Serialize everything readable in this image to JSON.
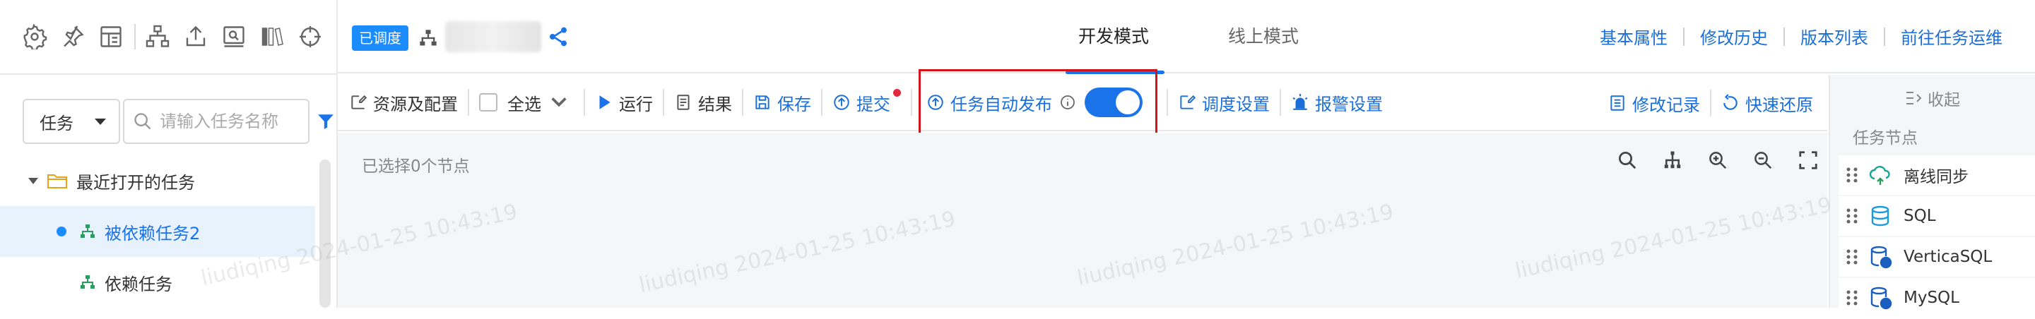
{
  "sidebar": {
    "search": {
      "type_value": "任务",
      "placeholder": "请输入任务名称"
    },
    "tree": [
      {
        "label": "最近打开的任务"
      },
      {
        "label": "被依赖任务2"
      },
      {
        "label": "依赖任务"
      }
    ]
  },
  "header": {
    "status_badge": "已调度",
    "modes": {
      "active": "开发模式",
      "inactive": "线上模式"
    },
    "links": [
      "基本属性",
      "修改历史",
      "版本列表",
      "前往任务运维"
    ]
  },
  "toolbar": {
    "resources": "资源及配置",
    "select_all": "全选",
    "run": "运行",
    "result": "结果",
    "save": "保存",
    "submit": "提交",
    "auto_publish": "任务自动发布",
    "auto_publish_enabled": true,
    "schedule_settings": "调度设置",
    "alarm_settings": "报警设置",
    "change_log": "修改记录",
    "quick_restore": "快速还原"
  },
  "canvas": {
    "selected_text": "已选择0个节点"
  },
  "right_panel": {
    "collapse": "收起",
    "title": "任务节点",
    "nodes": [
      "离线同步",
      "SQL",
      "VerticaSQL",
      "MySQL"
    ]
  },
  "watermark": "liudiqing 2024-01-25 10:43:19",
  "colors": {
    "accent": "#1a73e8",
    "link": "#1a6fd8",
    "highlight": "#d0151c",
    "badge": "#1a8cff"
  }
}
